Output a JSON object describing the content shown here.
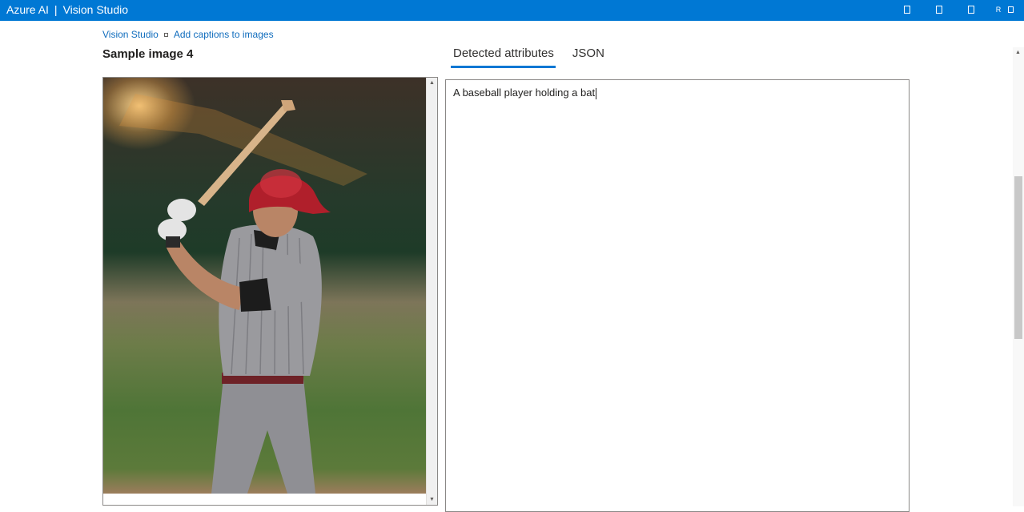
{
  "app": {
    "brand": "Azure AI",
    "separator": "|",
    "product": "Vision Studio",
    "avatar_initial": "R"
  },
  "breadcrumb": {
    "root": "Vision Studio",
    "current": "Add captions to images"
  },
  "page": {
    "title": "Sample image 4"
  },
  "tabs": [
    {
      "label": "Detected attributes",
      "active": true
    },
    {
      "label": "JSON",
      "active": false
    }
  ],
  "result": {
    "caption": "A baseball player holding a bat"
  },
  "colors": {
    "accent": "#0078d4",
    "link": "#0f6cbd"
  },
  "image": {
    "description_icon": "baseball-player-photo"
  }
}
